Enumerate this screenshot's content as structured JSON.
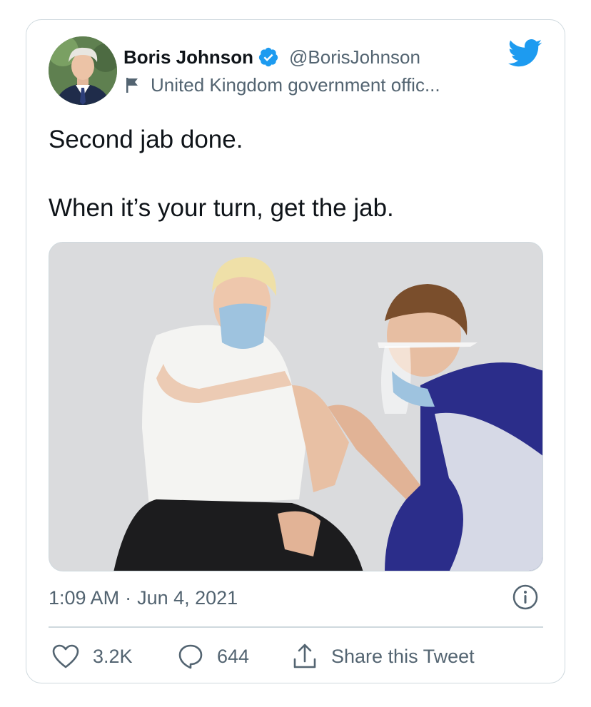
{
  "tweet": {
    "author": {
      "display_name": "Boris Johnson",
      "handle": "@BorisJohnson",
      "affiliation": "United Kingdom government offic...",
      "avatar": "avatar-photo",
      "verified_icon": "verified-badge-icon"
    },
    "text_line1": "Second jab done.",
    "text_line2": "When it’s your turn, get the jab.",
    "media": {
      "type": "photo",
      "icon": "photo"
    },
    "time": "1:09 AM",
    "separator": "·",
    "date": "Jun 4, 2021",
    "actions": {
      "likes": "3.2K",
      "replies": "644",
      "share_label": "Share this Tweet"
    }
  },
  "icons": [
    "verified-badge-icon",
    "flag-icon",
    "twitter-bird-icon",
    "info-icon",
    "heart-icon",
    "reply-bubble-icon",
    "share-icon"
  ],
  "colors": {
    "accent": "#1d9bf0",
    "text": "#0f1419",
    "secondary_text": "#536471",
    "border": "#cfd9de"
  }
}
